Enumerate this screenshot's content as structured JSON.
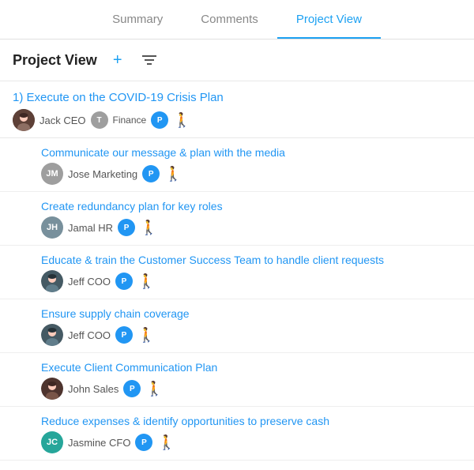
{
  "tabs": [
    {
      "id": "summary",
      "label": "Summary",
      "active": false
    },
    {
      "id": "comments",
      "label": "Comments",
      "active": false
    },
    {
      "id": "project-view",
      "label": "Project View",
      "active": true
    }
  ],
  "header": {
    "title": "Project View",
    "add_label": "+",
    "filter_label": "≡"
  },
  "project": {
    "title": "1) Execute on the COVID-19 Crisis Plan",
    "assignee_name": "Jack CEO",
    "badge_t": "T",
    "badge_finance": "Finance",
    "badge_p": "P",
    "subtasks": [
      {
        "title": "Communicate our message & plan with the media",
        "assignee_initials": "JM",
        "assignee_name": "Jose Marketing",
        "badge_p": "P"
      },
      {
        "title": "Create redundancy plan for key roles",
        "assignee_initials": "JH",
        "assignee_name": "Jamal HR",
        "badge_p": "P"
      },
      {
        "title": "Educate & train the Customer Success Team to handle client requests",
        "assignee_name": "Jeff COO",
        "badge_p": "P"
      },
      {
        "title": "Ensure supply chain coverage",
        "assignee_name": "Jeff COO",
        "badge_p": "P"
      },
      {
        "title": "Execute Client Communication Plan",
        "assignee_name": "John Sales",
        "badge_p": "P"
      },
      {
        "title": "Reduce expenses & identify opportunities to preserve cash",
        "assignee_initials": "JC",
        "assignee_name": "Jasmine CFO",
        "badge_p": "P"
      }
    ]
  }
}
